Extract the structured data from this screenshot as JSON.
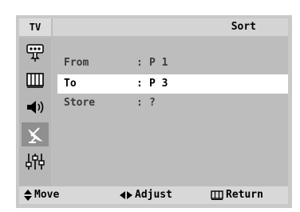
{
  "header": {
    "source_label": "TV",
    "title": "Sort"
  },
  "sidebar": {
    "items": [
      {
        "icon": "input-icon"
      },
      {
        "icon": "picture-icon"
      },
      {
        "icon": "sound-icon"
      },
      {
        "icon": "channel-icon",
        "active": true
      },
      {
        "icon": "setup-icon"
      }
    ]
  },
  "menu": {
    "rows": [
      {
        "label": "From",
        "separator": ":",
        "value": "P 1",
        "selected": false
      },
      {
        "label": "To",
        "separator": ":",
        "value": "P 3",
        "selected": true
      },
      {
        "label": "Store",
        "separator": ":",
        "value": "?",
        "selected": false
      }
    ]
  },
  "footer": {
    "move": "Move",
    "adjust": "Adjust",
    "return": "Return"
  }
}
